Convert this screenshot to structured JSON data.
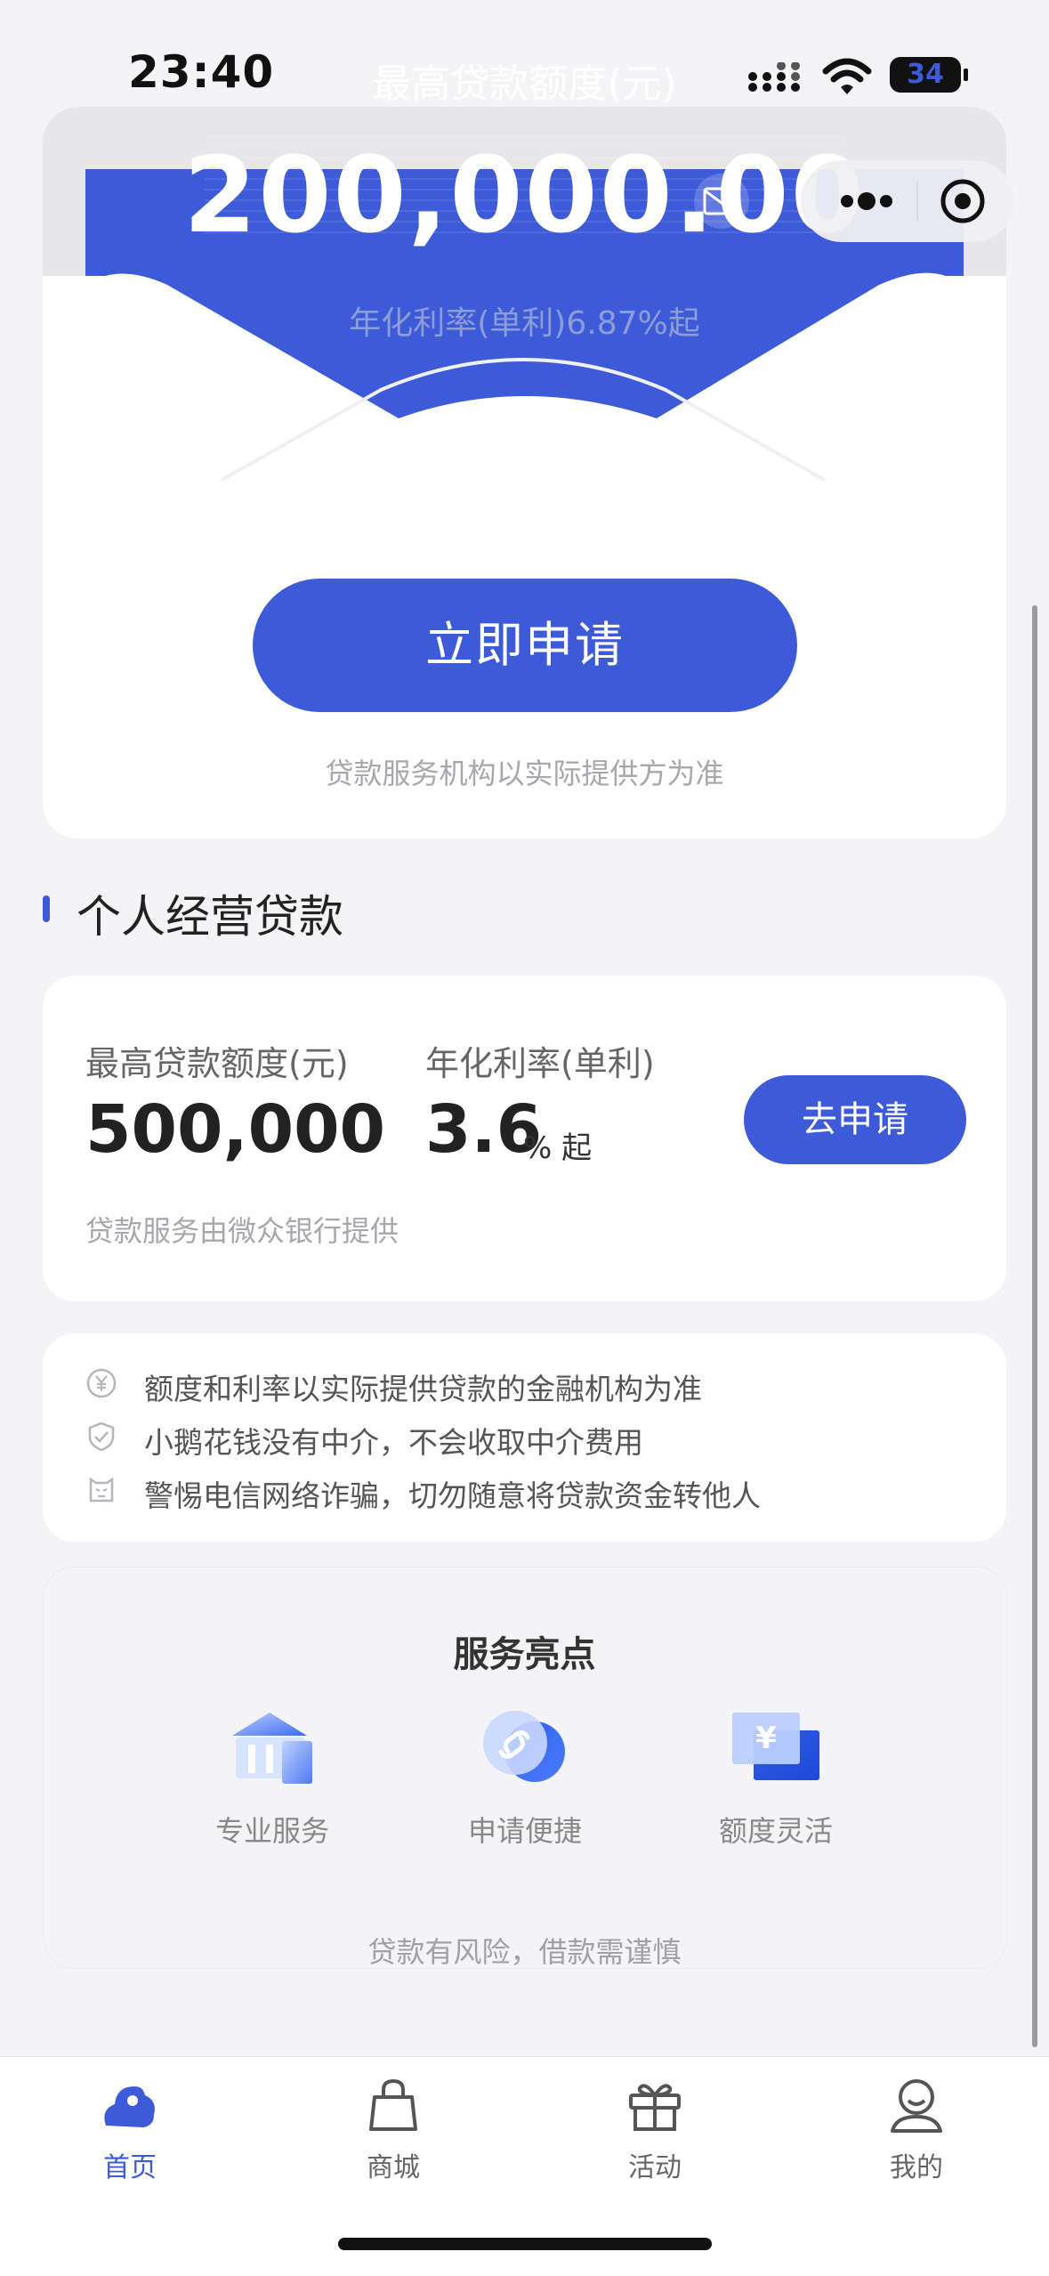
{
  "status_bar": {
    "time": "23:40",
    "battery": "34"
  },
  "hero": {
    "title": "最高贷款额度(元)",
    "amount": "200,000.00",
    "rate": "年化利率(单利)6.87%起",
    "apply_label": "立即申请",
    "service_note": "贷款服务机构以实际提供方为准"
  },
  "section": {
    "title": "个人经营贷款"
  },
  "loan_card": {
    "amount_label": "最高贷款额度(元)",
    "amount": "500,000",
    "rate_label": "年化利率(单利)",
    "rate": "3.6",
    "rate_unit": "% 起",
    "button_label": "去申请",
    "provider": "贷款服务由微众银行提供"
  },
  "notices": [
    {
      "icon": "yuan-circle-icon",
      "text": "额度和利率以实际提供贷款的金融机构为准"
    },
    {
      "icon": "shield-check-icon",
      "text": "小鹅花钱没有中介，不会收取中介费用"
    },
    {
      "icon": "warning-face-icon",
      "text": "警惕电信网络诈骗，切勿随意将贷款资金转他人"
    }
  ],
  "highlights": {
    "title": "服务亮点",
    "items": [
      {
        "icon": "bank-icon",
        "label": "专业服务"
      },
      {
        "icon": "link-circle-icon",
        "label": "申请便捷"
      },
      {
        "icon": "yuan-card-icon",
        "label": "额度灵活"
      }
    ],
    "risk_note": "贷款有风险，借款需谨慎"
  },
  "tabs": [
    {
      "icon": "home-icon",
      "label": "首页",
      "active": true
    },
    {
      "icon": "bag-icon",
      "label": "商城",
      "active": false
    },
    {
      "icon": "gift-icon",
      "label": "活动",
      "active": false
    },
    {
      "icon": "user-icon",
      "label": "我的",
      "active": false
    }
  ],
  "colors": {
    "accent": "#3d5bd9",
    "background": "#f4f4f6"
  }
}
